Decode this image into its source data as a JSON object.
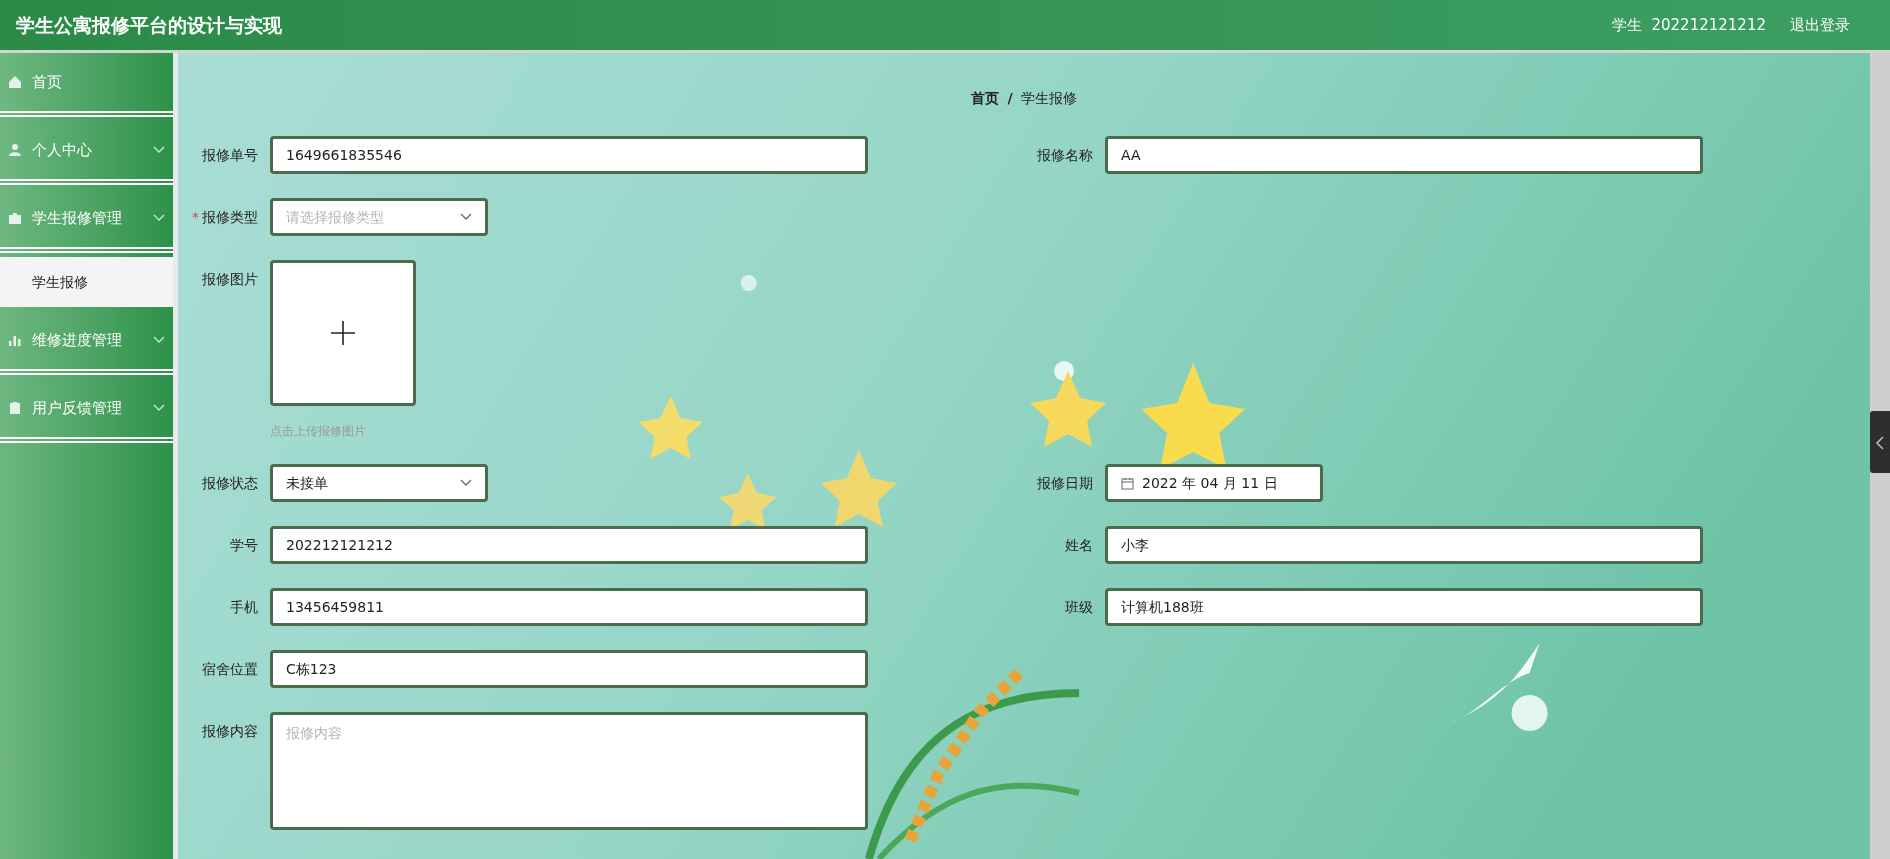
{
  "header": {
    "title": "学生公寓报修平台的设计与实现",
    "user_role": "学生",
    "user_id": "202212121212",
    "logout": "退出登录"
  },
  "sidebar": {
    "items": [
      {
        "label": "首页",
        "kind": "home",
        "expandable": false
      },
      {
        "label": "个人中心",
        "kind": "person",
        "expandable": true
      },
      {
        "label": "学生报修管理",
        "kind": "briefcase",
        "expandable": true,
        "children": [
          {
            "label": "学生报修",
            "selected": true
          }
        ]
      },
      {
        "label": "维修进度管理",
        "kind": "chart",
        "expandable": true
      },
      {
        "label": "用户反馈管理",
        "kind": "clipboard",
        "expandable": true
      }
    ]
  },
  "breadcrumb": {
    "items": [
      "首页",
      "学生报修"
    ],
    "separator": "/"
  },
  "form": {
    "rows": [
      {
        "fields": [
          {
            "kind": "text",
            "label": "报修单号",
            "value": "1649661835546"
          },
          {
            "kind": "text",
            "label": "报修名称",
            "value": "AA"
          }
        ]
      },
      {
        "fields": [
          {
            "kind": "select",
            "label": "报修类型",
            "required_mark": "*",
            "placeholder": "请选择报修类型"
          }
        ]
      },
      {
        "fields": [
          {
            "kind": "upload",
            "label": "报修图片",
            "hint": "点击上传报修图片"
          }
        ]
      },
      {
        "fields": [
          {
            "kind": "select",
            "label": "报修状态",
            "value": "未接单"
          },
          {
            "kind": "date",
            "label": "报修日期",
            "value": "2022 年 04 月 11 日"
          }
        ]
      },
      {
        "fields": [
          {
            "kind": "text",
            "label": "学号",
            "value": "202212121212"
          },
          {
            "kind": "text",
            "label": "姓名",
            "value": "小李"
          }
        ]
      },
      {
        "fields": [
          {
            "kind": "text",
            "label": "手机",
            "value": "13456459811"
          },
          {
            "kind": "text",
            "label": "班级",
            "value": "计算机188班"
          }
        ]
      },
      {
        "fields": [
          {
            "kind": "text",
            "label": "宿舍位置",
            "value": "C栋123"
          }
        ]
      },
      {
        "fields": [
          {
            "kind": "textarea",
            "label": "报修内容",
            "placeholder": "报修内容"
          }
        ]
      }
    ]
  }
}
